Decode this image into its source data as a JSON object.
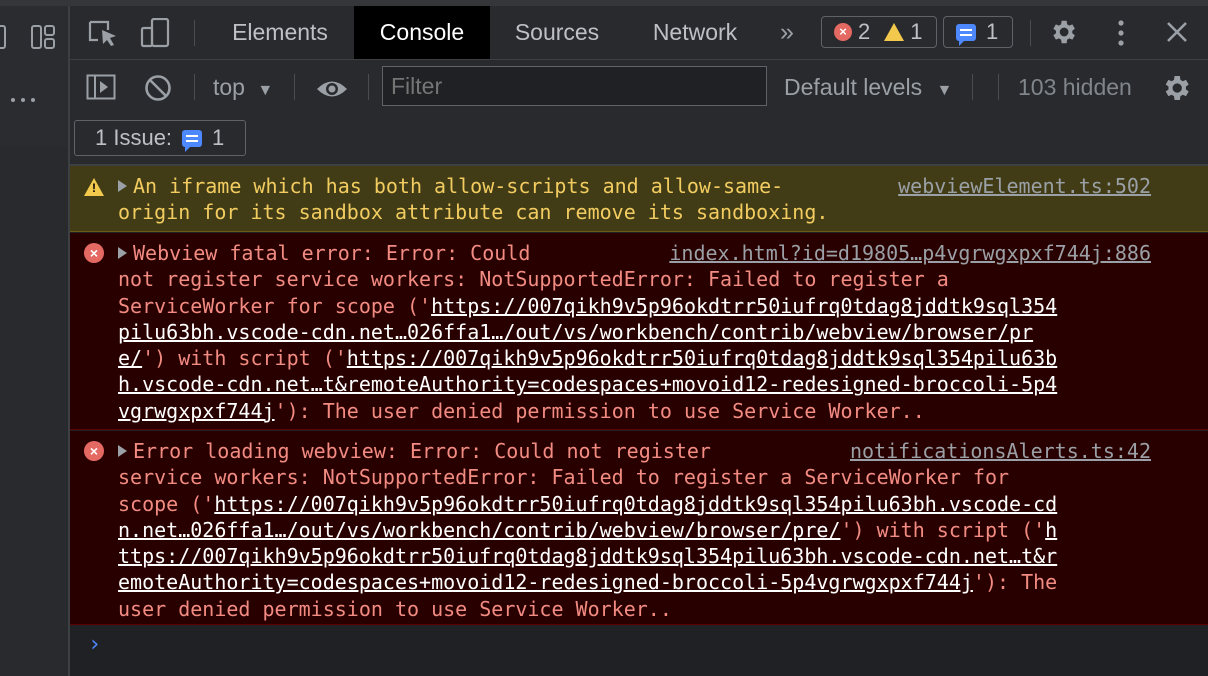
{
  "tabs": [
    {
      "label": "Elements"
    },
    {
      "label": "Console"
    },
    {
      "label": "Sources"
    },
    {
      "label": "Network"
    }
  ],
  "more_tabs": "»",
  "counts": {
    "errors": "2",
    "warnings": "1",
    "messages": "1"
  },
  "toolbar": {
    "context": "top",
    "filter_placeholder": "Filter",
    "levels": "Default levels",
    "hidden": "103 hidden"
  },
  "issues": {
    "label": "1 Issue:",
    "count": "1"
  },
  "messages": [
    {
      "level": "warning",
      "lines": [
        "An iframe which has both allow-scripts and allow-same-",
        "origin for its sandbox attribute can remove its sandboxing."
      ],
      "source": "webviewElement.ts:502"
    },
    {
      "level": "error",
      "source": "index.html?id=d19805…p4vgrwgxpxf744j:886",
      "l1": "Webview fatal error: Error: Could",
      "l2": "not register service workers: NotSupportedError: Failed to register a",
      "l3a": "ServiceWorker for scope ('",
      "l3b": "https://007qikh9v5p96okdtrr50iufrq0tdag8jddtk9sql354",
      "l4": "pilu63bh.vscode-cdn.net…026ffa1…/out/vs/workbench/contrib/webview/browser/pr",
      "l5a": "e/",
      "l5b": "') with script ('",
      "l5c": "https://007qikh9v5p96okdtrr50iufrq0tdag8jddtk9sql354pilu63b",
      "l6": "h.vscode-cdn.net…t&remoteAuthority=codespaces+movoid12-redesigned-broccoli-5p4",
      "l7a": "vgrwgxpxf744j",
      "l7b": "'): The user denied permission to use Service Worker.."
    },
    {
      "level": "error",
      "source": "notificationsAlerts.ts:42",
      "l1": "Error loading webview: Error: Could not register",
      "l2": "service workers: NotSupportedError: Failed to register a ServiceWorker for",
      "l3a": "scope ('",
      "l3b": "https://007qikh9v5p96okdtrr50iufrq0tdag8jddtk9sql354pilu63bh.vscode-cd",
      "l4a": "n.net…026ffa1…/out/vs/workbench/contrib/webview/browser/pre/",
      "l4b": "') with script ('",
      "l4c": "h",
      "l5": "ttps://007qikh9v5p96okdtrr50iufrq0tdag8jddtk9sql354pilu63bh.vscode-cdn.net…t&r",
      "l6a": "emoteAuthority=codespaces+movoid12-redesigned-broccoli-5p4vgrwgxpxf744j",
      "l6b": "'): The",
      "l7": "user denied permission to use Service Worker.."
    }
  ],
  "prompt_symbol": "›"
}
